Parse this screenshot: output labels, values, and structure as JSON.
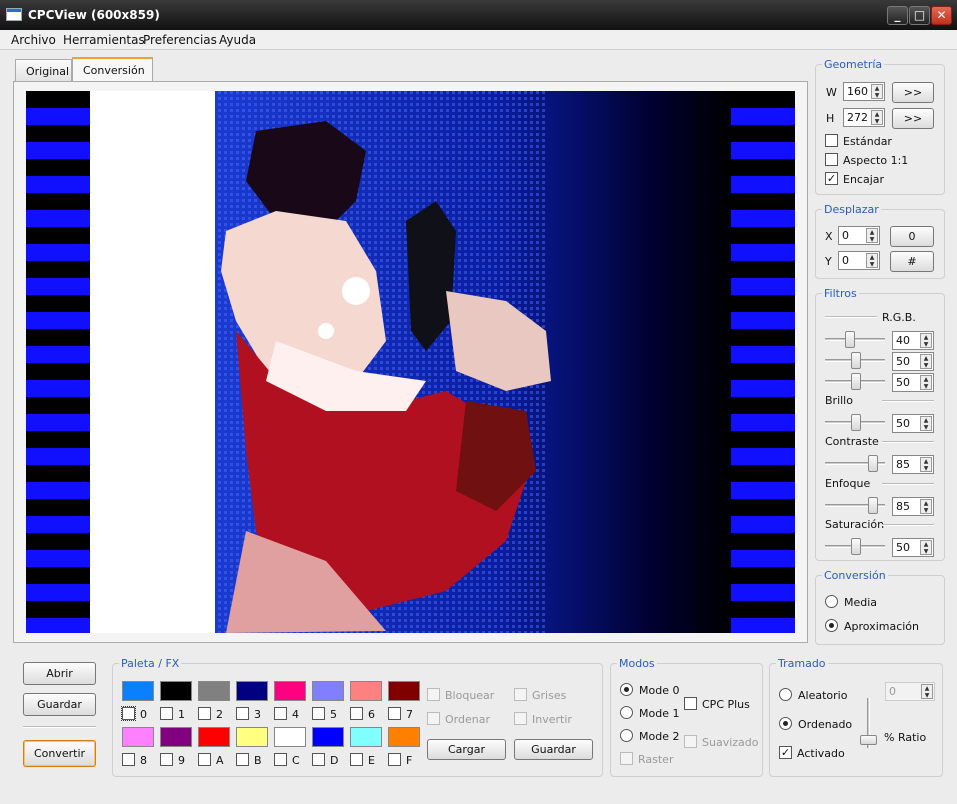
{
  "window": {
    "title": "CPCView (600x859)"
  },
  "menu": [
    "Archivo",
    "Herramientas",
    "Preferencias",
    "Ayuda"
  ],
  "tabs": [
    "Original",
    "Conversión"
  ],
  "geometria": {
    "title": "Geometría",
    "w_label": "W",
    "w_value": "160",
    "h_label": "H",
    "h_value": "272",
    "btn_label": ">>",
    "checks": [
      {
        "label": "Estándar",
        "checked": false
      },
      {
        "label": "Aspecto 1:1",
        "checked": false
      },
      {
        "label": "Encajar",
        "checked": true
      }
    ]
  },
  "desplazar": {
    "title": "Desplazar",
    "x_label": "X",
    "x_value": "0",
    "x_btn": "0",
    "y_label": "Y",
    "y_value": "0",
    "y_btn": "#"
  },
  "filtros": {
    "title": "Filtros",
    "rgb_label": "R.G.B.",
    "rgb": [
      "40",
      "50",
      "50"
    ],
    "brillo_label": "Brillo",
    "brillo": "50",
    "contraste_label": "Contraste",
    "contraste": "85",
    "enfoque_label": "Enfoque",
    "enfoque": "85",
    "saturacion_label": "Saturación",
    "saturacion": "50"
  },
  "conversion": {
    "title": "Conversión",
    "options": [
      {
        "label": "Media",
        "selected": false
      },
      {
        "label": "Aproximación",
        "selected": true
      }
    ]
  },
  "actions": {
    "abrir": "Abrir",
    "guardar": "Guardar",
    "convertir": "Convertir"
  },
  "paleta": {
    "title": "Paleta / FX",
    "colors": [
      {
        "id": "0",
        "color": "#0a80ff"
      },
      {
        "id": "1",
        "color": "#000000"
      },
      {
        "id": "2",
        "color": "#808080"
      },
      {
        "id": "3",
        "color": "#000080"
      },
      {
        "id": "4",
        "color": "#ff0080"
      },
      {
        "id": "5",
        "color": "#8080ff"
      },
      {
        "id": "6",
        "color": "#ff8080"
      },
      {
        "id": "7",
        "color": "#800000"
      },
      {
        "id": "8",
        "color": "#ff80ff"
      },
      {
        "id": "9",
        "color": "#800080"
      },
      {
        "id": "A",
        "color": "#ff0000"
      },
      {
        "id": "B",
        "color": "#ffff80"
      },
      {
        "id": "C",
        "color": "#ffffff"
      },
      {
        "id": "D",
        "color": "#0000ff"
      },
      {
        "id": "E",
        "color": "#80ffff"
      },
      {
        "id": "F",
        "color": "#ff8000"
      }
    ],
    "fx_checks": [
      "Bloquear",
      "Grises",
      "Ordenar",
      "Invertir"
    ],
    "cargar": "Cargar",
    "guardar": "Guardar"
  },
  "modos": {
    "title": "Modos",
    "modes": [
      {
        "label": "Mode 0",
        "selected": true
      },
      {
        "label": "Mode 1",
        "selected": false
      },
      {
        "label": "Mode 2",
        "selected": false
      }
    ],
    "cpc_plus": "CPC Plus",
    "suavizado": "Suavizado",
    "raster": "Raster"
  },
  "tramado": {
    "title": "Tramado",
    "aleatorio": "Aleatorio",
    "ordenado": "Ordenado",
    "activado": "Activado",
    "ratio_value": "0",
    "ratio_label": "% Ratio"
  }
}
